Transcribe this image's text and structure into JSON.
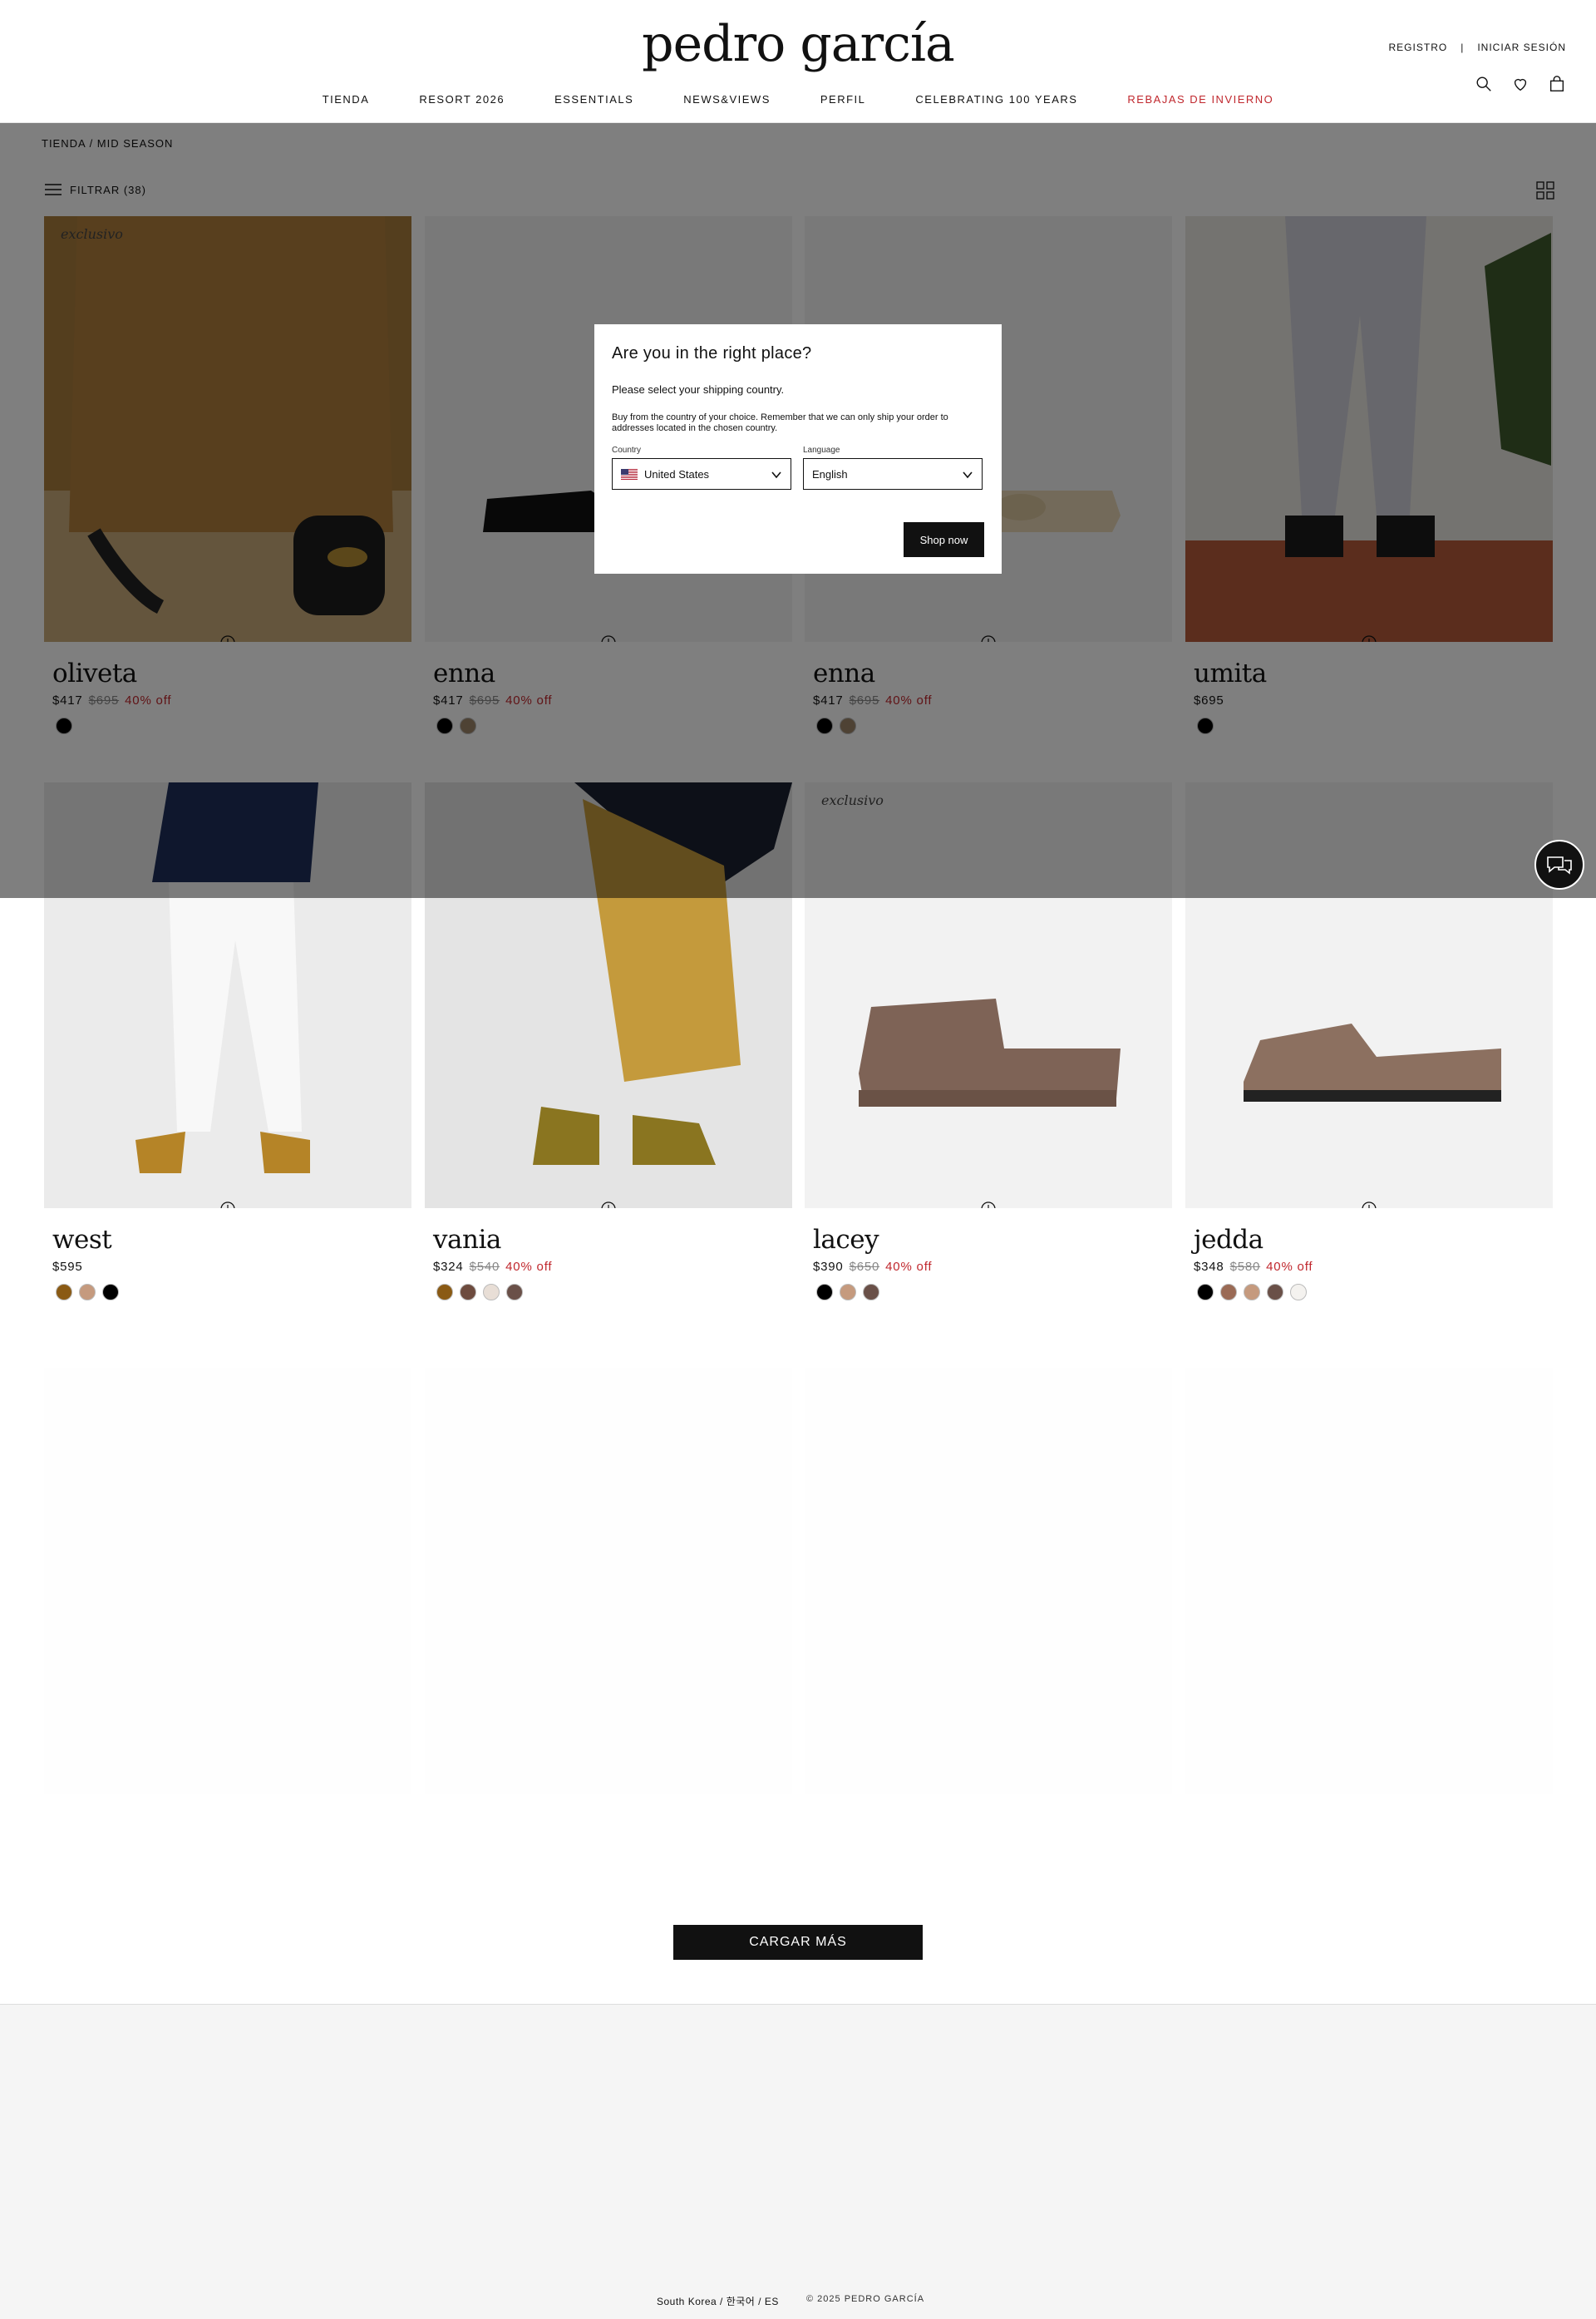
{
  "header": {
    "logo": "pedro garcía",
    "register": "REGISTRO",
    "login": "INICIAR SESIÓN",
    "nav": [
      "TIENDA",
      "RESORT 2026",
      "ESSENTIALS",
      "NEWS&VIEWS",
      "PERFIL",
      "CELEBRATING 100 YEARS",
      "REBAJAS DE INVIERNO"
    ]
  },
  "breadcrumb": "TIENDA / MID SEASON",
  "filter_label": "FILTRAR (38)",
  "exclusive_label": "exclusivo",
  "products": [
    {
      "name": "oliveta",
      "price": "$417",
      "old": "$695",
      "off": "40% off",
      "swatches": [
        "#000000"
      ]
    },
    {
      "name": "enna",
      "price": "$417",
      "old": "$695",
      "off": "40% off",
      "swatches": [
        "#000000",
        "#9c8468"
      ]
    },
    {
      "name": "enna",
      "price": "$417",
      "old": "$695",
      "off": "40% off",
      "swatches": [
        "#000000",
        "#9c8468"
      ]
    },
    {
      "name": "umita",
      "price": "$695",
      "old": "",
      "off": "",
      "swatches": [
        "#000000"
      ]
    },
    {
      "name": "west",
      "price": "$595",
      "old": "",
      "off": "",
      "swatches": [
        "#8a5a14",
        "#c59a7e",
        "#000000"
      ]
    },
    {
      "name": "vania",
      "price": "$324",
      "old": "$540",
      "off": "40% off",
      "swatches": [
        "#8a5a14",
        "#6d4b3e",
        "#e8ded6",
        "#6a5048"
      ]
    },
    {
      "name": "lacey",
      "price": "$390",
      "old": "$650",
      "off": "40% off",
      "swatches": [
        "#000000",
        "#c59a7e",
        "#6a5048"
      ]
    },
    {
      "name": "jedda",
      "price": "$348",
      "old": "$580",
      "off": "40% off",
      "swatches": [
        "#000000",
        "#9a6a55",
        "#c59a7e",
        "#6a5048",
        "#f4f2ef"
      ]
    }
  ],
  "modal": {
    "title": "Are you in the right place?",
    "subtitle": "Please select your shipping country.",
    "note": "Buy from the country of your choice. Remember that we can only ship your order to addresses located in the chosen country.",
    "country_label": "Country",
    "country_value": "United States",
    "language_label": "Language",
    "language_value": "English",
    "button": "Shop now"
  },
  "load_more": "CARGAR MÁS",
  "footer": {
    "locale": "South Korea / 한국어 / ES",
    "copyright": "© 2025 PEDRO GARCÍA"
  }
}
